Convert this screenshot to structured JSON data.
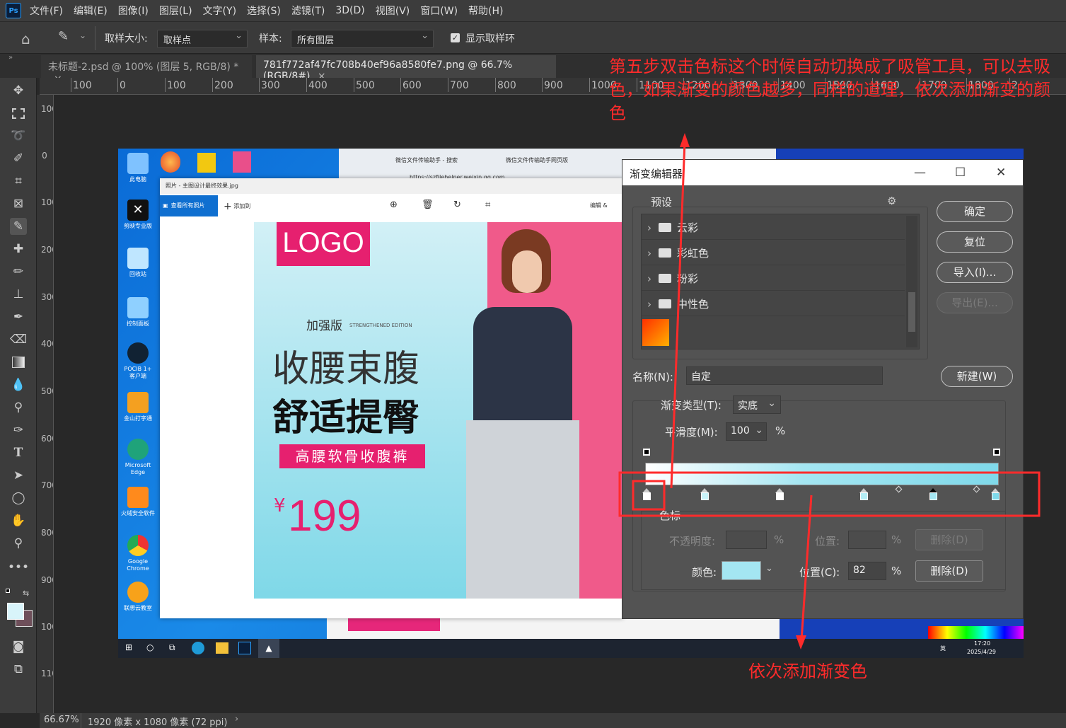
{
  "menu": [
    "文件(F)",
    "编辑(E)",
    "图像(I)",
    "图层(L)",
    "文字(Y)",
    "选择(S)",
    "滤镜(T)",
    "3D(D)",
    "视图(V)",
    "窗口(W)",
    "帮助(H)"
  ],
  "app_logo": "Ps",
  "options": {
    "sample_size_label": "取样大小:",
    "sample_size_value": "取样点",
    "sample_label": "样本:",
    "sample_value": "所有图层",
    "show_ring_label": "显示取样环"
  },
  "tabs": [
    {
      "label": "未标题-2.psd @ 100% (图层 5, RGB/8) *",
      "close": "×"
    },
    {
      "label": "781f772af47fc708b40ef96a8580fe7.png @ 66.7%(RGB/8#)",
      "close": "×"
    }
  ],
  "ruler_h": [
    "100",
    "0",
    "100",
    "200",
    "300",
    "400",
    "500",
    "600",
    "700",
    "800",
    "900",
    "1000",
    "1100",
    "1200",
    "1300",
    "1400",
    "1500",
    "1600",
    "1700",
    "1800",
    "2"
  ],
  "ruler_v": [
    "100",
    "0",
    "100",
    "200",
    "300",
    "400",
    "500",
    "600",
    "700",
    "800",
    "900",
    "1000",
    "1100"
  ],
  "status": {
    "zoom": "66.67%",
    "doc_size": "1920 像素 x 1080 像素 (72 ppi)"
  },
  "desktop": {
    "icons": [
      "此电脑",
      "剪映专业版",
      "回收站",
      "控制面板",
      "POCIB 1+ 客户端",
      "金山打字通",
      "Microsoft Edge",
      "火绒安全软件",
      "Google Chrome",
      "联想云教室"
    ],
    "browser_tabs": [
      "微信文件传输助手 - 搜索",
      "微信文件传输助手网页版"
    ],
    "browser_url": "https://szfilehelper.weixin.qq.com",
    "photos_title": "照片 - 主图设计最终效果.jpg",
    "photos_all": "查看所有照片",
    "photos_add": "添加到",
    "photos_edit": "编辑 &",
    "clock_time": "17:20",
    "clock_date": "2025/4/29",
    "tray_lang": "英"
  },
  "poster": {
    "logo": "LOGO",
    "edition": "加强版",
    "edition_en": "STRENGTHENED EDITION",
    "headline1": "收腰束腹",
    "headline2": "舒适提臀",
    "banner": "高腰软骨收腹裤",
    "price_symbol": "¥",
    "price": "199"
  },
  "gradient_editor": {
    "title": "渐变编辑器",
    "presets_label": "预设",
    "preset_folders": [
      "云彩",
      "彩虹色",
      "粉彩",
      "中性色"
    ],
    "ok": "确定",
    "reset": "复位",
    "import": "导入(I)...",
    "export": "导出(E)...",
    "name_label": "名称(N):",
    "name_value": "自定",
    "new": "新建(W)",
    "type_label": "渐变类型(T):",
    "type_value": "实底",
    "smooth_label": "平滑度(M):",
    "smooth_value": "100",
    "percent": "%",
    "stops_label": "色标",
    "opacity_label": "不透明度:",
    "location_label": "位置:",
    "delete_label": "删除(D)",
    "color_label": "颜色:",
    "color_location_label": "位置(C):",
    "color_location_value": "82",
    "stop_color": "#a4e6f2",
    "gradient_start": "#ffffff",
    "gradient_end": "#7fd9ea"
  },
  "annotations": {
    "top": "第五步双击色标这个时候自动切换成了吸管工具，可以去吸色，如果渐变的颜色越多，同样的道理，依次添加渐变的颜色",
    "bottom": "依次添加渐变色",
    "color": "#ff2b2b"
  }
}
